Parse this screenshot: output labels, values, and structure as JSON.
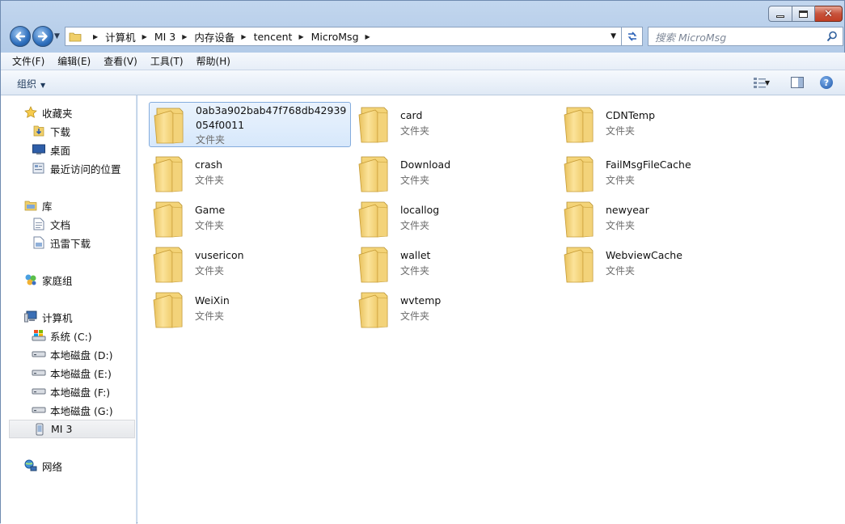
{
  "window": {
    "minimize_label": "—",
    "maximize_label": "□",
    "close_label": "✕"
  },
  "address": {
    "crumbs": [
      "计算机",
      "MI 3",
      "内存设备",
      "tencent",
      "MicroMsg"
    ]
  },
  "search": {
    "placeholder": "搜索 MicroMsg"
  },
  "menu": {
    "items": [
      "文件(F)",
      "编辑(E)",
      "查看(V)",
      "工具(T)",
      "帮助(H)"
    ]
  },
  "toolbar": {
    "organize_label": "组织",
    "help_label": "?"
  },
  "sidebar": {
    "favorites": {
      "label": "收藏夹",
      "items": [
        "下载",
        "桌面",
        "最近访问的位置"
      ]
    },
    "libraries": {
      "label": "库",
      "items": [
        "文档",
        "迅雷下载"
      ]
    },
    "homegroup": {
      "label": "家庭组"
    },
    "computer": {
      "label": "计算机",
      "items": [
        "系统 (C:)",
        "本地磁盘 (D:)",
        "本地磁盘 (E:)",
        "本地磁盘 (F:)",
        "本地磁盘 (G:)",
        "MI 3"
      ]
    },
    "network": {
      "label": "网络"
    }
  },
  "folder_type": "文件夹",
  "files": [
    {
      "name": "0ab3a902bab47f768db42939054f0011",
      "type": "文件夹"
    },
    {
      "name": "card",
      "type": "文件夹"
    },
    {
      "name": "CDNTemp",
      "type": "文件夹"
    },
    {
      "name": "crash",
      "type": "文件夹"
    },
    {
      "name": "Download",
      "type": "文件夹"
    },
    {
      "name": "FailMsgFileCache",
      "type": "文件夹"
    },
    {
      "name": "Game",
      "type": "文件夹"
    },
    {
      "name": "locallog",
      "type": "文件夹"
    },
    {
      "name": "newyear",
      "type": "文件夹"
    },
    {
      "name": "vusericon",
      "type": "文件夹"
    },
    {
      "name": "wallet",
      "type": "文件夹"
    },
    {
      "name": "WebviewCache",
      "type": "文件夹"
    },
    {
      "name": "WeiXin",
      "type": "文件夹"
    },
    {
      "name": "wvtemp",
      "type": "文件夹"
    }
  ],
  "colors": {
    "selection_border": "#84acdd",
    "frame": "#b3cbe8",
    "folder_yellow": "#f2d06b"
  }
}
